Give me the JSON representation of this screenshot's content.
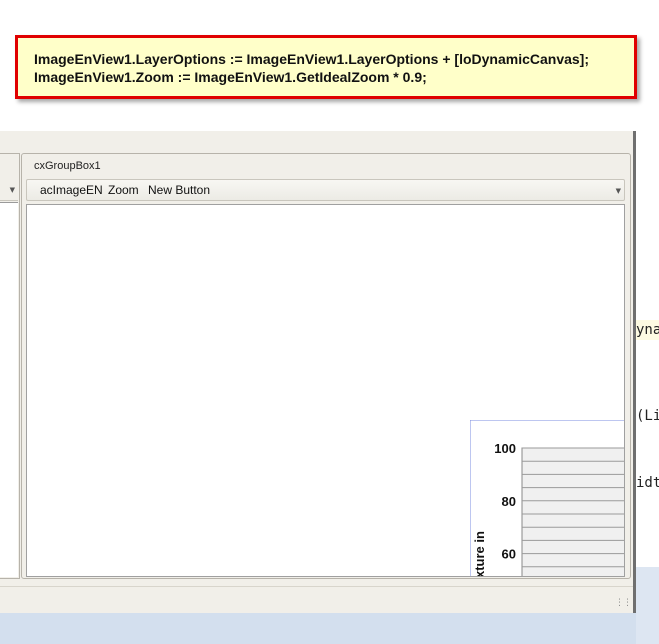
{
  "callout": {
    "line1": "ImageEnView1.LayerOptions := ImageEnView1.LayerOptions + [loDynamicCanvas];",
    "line2": "ImageEnView1.Zoom := ImageEnView1.GetIdealZoom * 0.9;"
  },
  "background_code": {
    "peek1": "yna",
    "peek2": "(Li",
    "peek3": "idt"
  },
  "groupbox": {
    "caption": "cxGroupBox1",
    "toolbar": [
      "acImageEN",
      "Zoom",
      "New Button"
    ]
  },
  "chart_data": {
    "type": "bar",
    "ylabel_visible": "xture in",
    "yticks": [
      60,
      80,
      100
    ],
    "ylim": [
      50,
      100
    ],
    "grid": true,
    "partial": true
  },
  "colors": {
    "callout_border": "#e00000",
    "callout_bg": "#ffffc9",
    "chart_frame": "#7b8ee0"
  }
}
